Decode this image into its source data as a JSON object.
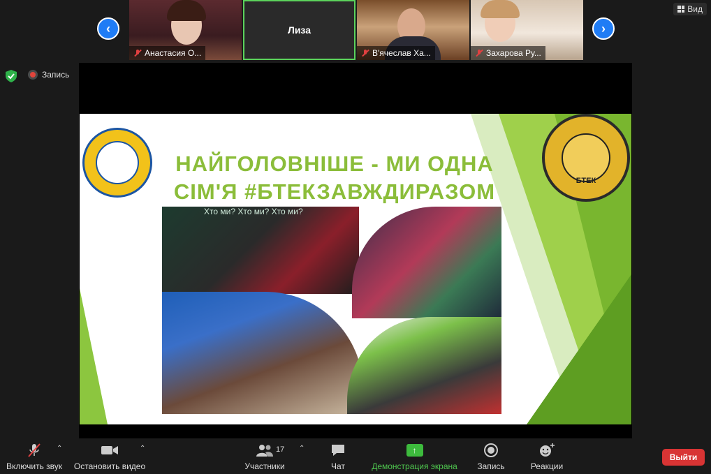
{
  "participants": [
    {
      "name": "Анастасия О...",
      "muted": true
    },
    {
      "name": "Лиза",
      "muted": false,
      "active_speaker": true
    },
    {
      "name": "В'ячеслав Ха...",
      "muted": true
    },
    {
      "name": "Захарова Ру...",
      "muted": true
    }
  ],
  "view_button": "Вид",
  "recording_indicator": "Запись",
  "slide": {
    "title_line1": "НАЙГОЛОВНІШЕ - МИ ОДНА",
    "title_line2": "СІМ'Я  #БТЕКЗАВЖДИРАЗОМ",
    "photo_caption": "Хто ми? Хто ми? Хто ми?",
    "logo_right_text": "БТЕК"
  },
  "toolbar": {
    "unmute": "Включить звук",
    "stop_video": "Остановить видео",
    "participants": "Участники",
    "participants_count": "17",
    "chat": "Чат",
    "share_screen": "Демонстрация экрана",
    "record": "Запись",
    "reactions": "Реакции",
    "leave": "Выйти"
  },
  "colors": {
    "accent_blue": "#1f7cf5",
    "share_green": "#3dbb3d",
    "leave_red": "#d83434",
    "slide_title_green": "#8bbd3a"
  }
}
